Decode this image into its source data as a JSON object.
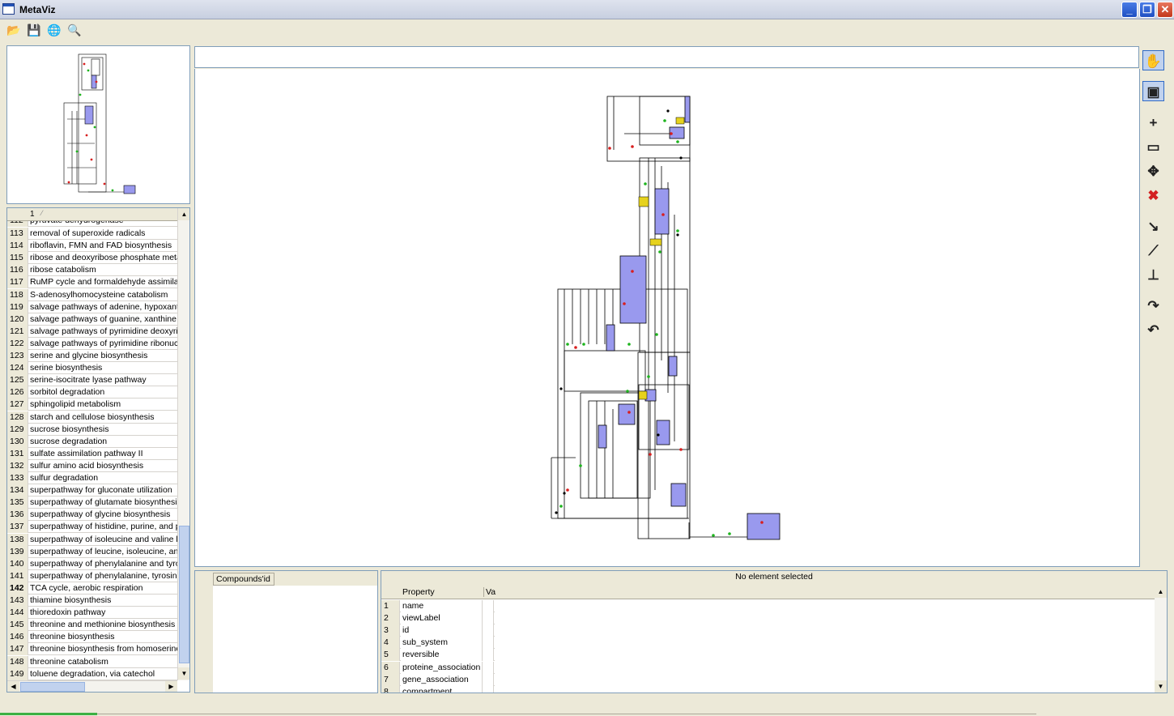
{
  "window": {
    "title": "MetaViz"
  },
  "toolbar": {
    "buttons": [
      {
        "name": "open-folder-icon",
        "glyph": "📂"
      },
      {
        "name": "save-icon",
        "glyph": "💾"
      },
      {
        "name": "globe-icon",
        "glyph": "🌐"
      },
      {
        "name": "zoom-search-icon",
        "glyph": "🔍"
      }
    ]
  },
  "pathway_list": {
    "header": "1",
    "partial_top": "pyruvate dehydrogenase",
    "selected_number": "142",
    "rows": [
      {
        "num": "113",
        "label": "removal of superoxide radicals"
      },
      {
        "num": "114",
        "label": "riboflavin, FMN and FAD biosynthesis"
      },
      {
        "num": "115",
        "label": "ribose and deoxyribose phosphate meta"
      },
      {
        "num": "116",
        "label": "ribose catabolism"
      },
      {
        "num": "117",
        "label": "RuMP cycle and formaldehyde assimilat"
      },
      {
        "num": "118",
        "label": "S-adenosylhomocysteine catabolism"
      },
      {
        "num": "119",
        "label": "salvage pathways of adenine, hypoxanth"
      },
      {
        "num": "120",
        "label": "salvage pathways of guanine, xanthine, a"
      },
      {
        "num": "121",
        "label": "salvage pathways of pyrimidine deoxyrib"
      },
      {
        "num": "122",
        "label": "salvage pathways of pyrimidine ribonucl"
      },
      {
        "num": "123",
        "label": "serine and glycine biosynthesis"
      },
      {
        "num": "124",
        "label": "serine biosynthesis"
      },
      {
        "num": "125",
        "label": "serine-isocitrate lyase pathway"
      },
      {
        "num": "126",
        "label": "sorbitol degradation"
      },
      {
        "num": "127",
        "label": "sphingolipid metabolism"
      },
      {
        "num": "128",
        "label": "starch and cellulose biosynthesis"
      },
      {
        "num": "129",
        "label": "sucrose biosynthesis"
      },
      {
        "num": "130",
        "label": "sucrose degradation"
      },
      {
        "num": "131",
        "label": "sulfate assimilation pathway II"
      },
      {
        "num": "132",
        "label": "sulfur amino acid biosynthesis"
      },
      {
        "num": "133",
        "label": "sulfur degradation"
      },
      {
        "num": "134",
        "label": "superpathway for gluconate utilization"
      },
      {
        "num": "135",
        "label": "superpathway of glutamate biosynthesis"
      },
      {
        "num": "136",
        "label": "superpathway of glycine biosynthesis"
      },
      {
        "num": "137",
        "label": "superpathway of histidine, purine, and py"
      },
      {
        "num": "138",
        "label": "superpathway of isoleucine and valine b"
      },
      {
        "num": "139",
        "label": "superpathway of leucine, isoleucine, and"
      },
      {
        "num": "140",
        "label": "superpathway of phenylalanine and tyros"
      },
      {
        "num": "141",
        "label": "superpathway of phenylalanine, tyrosine"
      },
      {
        "num": "142",
        "label": "TCA cycle, aerobic respiration"
      },
      {
        "num": "143",
        "label": "thiamine biosynthesis"
      },
      {
        "num": "144",
        "label": "thioredoxin pathway"
      },
      {
        "num": "145",
        "label": "threonine and methionine biosynthesis"
      },
      {
        "num": "146",
        "label": "threonine biosynthesis"
      },
      {
        "num": "147",
        "label": "threonine biosynthesis from homoserine"
      },
      {
        "num": "148",
        "label": "threonine catabolism"
      },
      {
        "num": "149",
        "label": "toluene degradation, via catechol"
      }
    ]
  },
  "palette": {
    "tools": [
      {
        "name": "hand-pan-icon",
        "glyph": "✋",
        "active": true
      },
      {
        "name": "select-node-icon",
        "glyph": "▣",
        "active": true
      },
      {
        "name": "add-icon",
        "glyph": "+",
        "active": false
      },
      {
        "name": "box-select-icon",
        "glyph": "▭",
        "active": false
      },
      {
        "name": "move-icon",
        "glyph": "✥",
        "active": false
      },
      {
        "name": "delete-icon",
        "glyph": "✖",
        "active": false
      },
      {
        "name": "curve-down-icon",
        "glyph": "↘",
        "active": false
      },
      {
        "name": "line-draw-icon",
        "glyph": "⟋",
        "active": false
      },
      {
        "name": "stamp-icon",
        "glyph": "⊥",
        "active": false
      },
      {
        "name": "redo-icon",
        "glyph": "↷",
        "active": false
      },
      {
        "name": "undo-icon",
        "glyph": "↶",
        "active": false
      }
    ]
  },
  "compounds_panel": {
    "tab_label": "Compounds'id"
  },
  "properties_panel": {
    "status": "No element selected",
    "col_property": "Property",
    "col_value": "Va",
    "rows": [
      {
        "num": "1",
        "label": "name"
      },
      {
        "num": "2",
        "label": "viewLabel"
      },
      {
        "num": "3",
        "label": "id"
      },
      {
        "num": "4",
        "label": "sub_system"
      },
      {
        "num": "5",
        "label": "reversible"
      },
      {
        "num": "6",
        "label": "proteine_association"
      },
      {
        "num": "7",
        "label": "gene_association"
      },
      {
        "num": "8",
        "label": "compartment"
      }
    ]
  },
  "colors": {
    "node_fill": "#9999ee",
    "edge": "#000000",
    "metabolite_red": "#d81e1e",
    "metabolite_green": "#1eb41e",
    "metabolite_yellow": "#e6d21e"
  }
}
